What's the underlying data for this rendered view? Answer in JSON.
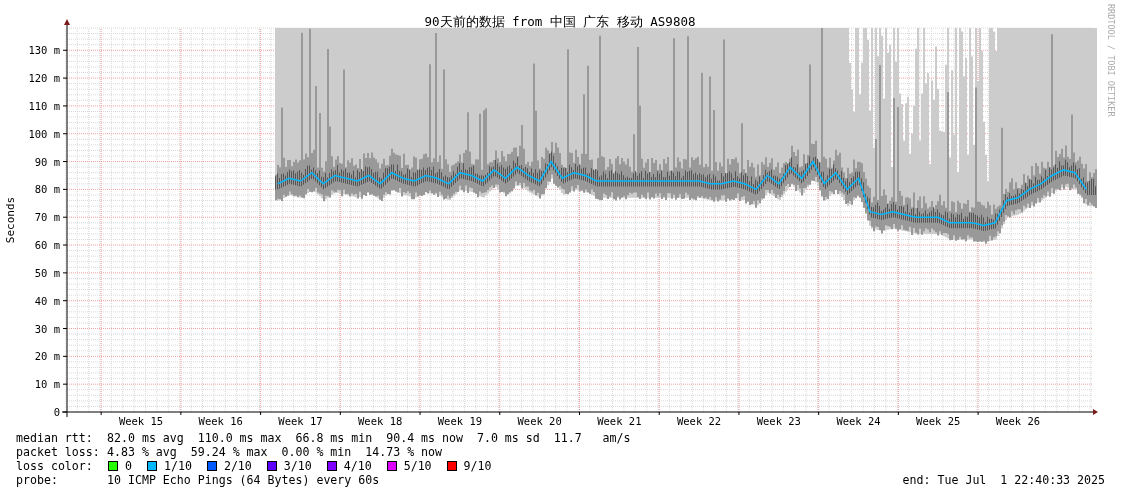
{
  "graph": {
    "credit": "RRDTOOL / TOBI OETIKER",
    "chart_data": {
      "type": "line",
      "title": "90天前的数据 from 中国 广东 移动 AS9808",
      "ylabel": "Seconds",
      "grid": true,
      "ylim": [
        0,
        138
      ],
      "yticks": [
        {
          "value": 0,
          "label": "0"
        },
        {
          "value": 10,
          "label": "10 m"
        },
        {
          "value": 20,
          "label": "20 m"
        },
        {
          "value": 30,
          "label": "30 m"
        },
        {
          "value": 40,
          "label": "40 m"
        },
        {
          "value": 50,
          "label": "50 m"
        },
        {
          "value": 60,
          "label": "60 m"
        },
        {
          "value": 70,
          "label": "70 m"
        },
        {
          "value": 80,
          "label": "80 m"
        },
        {
          "value": 90,
          "label": "90 m"
        },
        {
          "value": 100,
          "label": "100 m"
        },
        {
          "value": 110,
          "label": "110 m"
        },
        {
          "value": 120,
          "label": "120 m"
        },
        {
          "value": 130,
          "label": "130 m"
        }
      ],
      "categories": [
        null,
        null,
        null,
        null,
        null,
        null,
        "Week 15",
        null,
        null,
        null,
        null,
        null,
        null,
        "Week 16",
        null,
        null,
        null,
        null,
        null,
        null,
        "Week 17",
        null,
        null,
        null,
        null,
        null,
        null,
        "Week 18",
        null,
        null,
        null,
        null,
        null,
        null,
        "Week 19",
        null,
        null,
        null,
        null,
        null,
        null,
        "Week 20",
        null,
        null,
        null,
        null,
        null,
        null,
        "Week 21",
        null,
        null,
        null,
        null,
        null,
        null,
        "Week 22",
        null,
        null,
        null,
        null,
        null,
        null,
        "Week 23",
        null,
        null,
        null,
        null,
        null,
        null,
        "Week 24",
        null,
        null,
        null,
        null,
        null,
        null,
        "Week 25",
        null,
        null,
        null,
        null,
        null,
        null,
        "Week 26",
        null,
        null,
        null,
        null,
        null,
        null
      ],
      "series": [
        {
          "name": "median rtt:",
          "color": "#00b8ff",
          "values": [
            null,
            null,
            null,
            null,
            null,
            null,
            null,
            null,
            null,
            null,
            null,
            null,
            null,
            null,
            null,
            null,
            null,
            null,
            82,
            84,
            83,
            86,
            82,
            85,
            84,
            83,
            85,
            82,
            86,
            84,
            83,
            85,
            84,
            82,
            86,
            85,
            83,
            87,
            84,
            88,
            85,
            83,
            90,
            84,
            86,
            85,
            83,
            83,
            83,
            83,
            83,
            83,
            83,
            83,
            83,
            83,
            82,
            82,
            83,
            82,
            80,
            85,
            82,
            88,
            84,
            90,
            82,
            86,
            80,
            84,
            72,
            71,
            72,
            71,
            70,
            70,
            70,
            68,
            68,
            68,
            67,
            68,
            76,
            77,
            80,
            82,
            85,
            87,
            86,
            80
          ]
        }
      ]
    }
  },
  "legend": {
    "median_rtt": {
      "text": "82.0 ms avg  110.0 ms max  66.8 ms min  90.4 ms now  7.0 ms sd  11.7   am/s"
    },
    "packet_loss": {
      "label": "packet loss:",
      "text": "4.83 % avg  59.24 % max  0.00 % min  14.73 % now"
    },
    "loss_color": {
      "label": "loss color:",
      "items": [
        {
          "label": "0",
          "color": "#26ff00"
        },
        {
          "label": "1/10",
          "color": "#00b8ff"
        },
        {
          "label": "2/10",
          "color": "#0059ff"
        },
        {
          "label": "3/10",
          "color": "#5e00ff"
        },
        {
          "label": "4/10",
          "color": "#7e00ff"
        },
        {
          "label": "5/10",
          "color": "#dd00ff"
        },
        {
          "label": "9/10",
          "color": "#ff0000"
        }
      ]
    },
    "probe": {
      "label": "probe:",
      "text": "10 ICMP Echo Pings (64 Bytes) every 60s"
    },
    "end": "end: Tue Jul  1 22:40:33 2025"
  }
}
